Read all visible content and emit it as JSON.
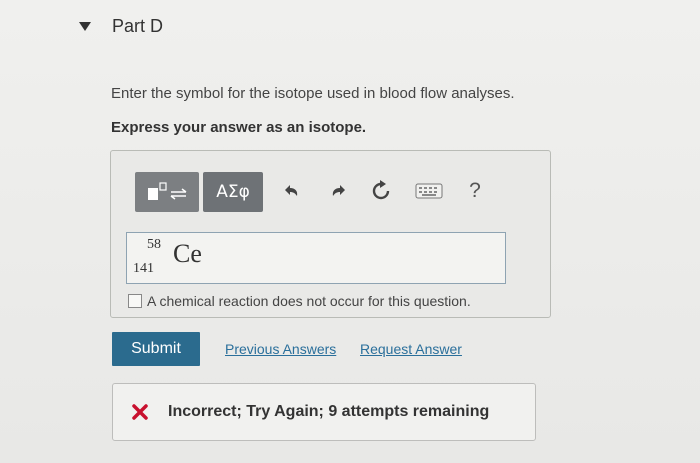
{
  "part": {
    "title": "Part D"
  },
  "question": {
    "prompt": "Enter the symbol for the isotope used in blood flow analyses.",
    "instruction": "Express your answer as an isotope."
  },
  "toolbar": {
    "symbols_label": "ΑΣφ",
    "help_label": "?",
    "icons": [
      "templates-icon",
      "undo-icon",
      "redo-icon",
      "reset-icon",
      "keyboard-icon",
      "help-icon"
    ]
  },
  "answer": {
    "mass_number": "58",
    "atomic_number": "141",
    "symbol": "Ce"
  },
  "no_reaction_label": "A chemical reaction does not occur for this question.",
  "actions": {
    "submit_label": "Submit",
    "previous_answers_label": "Previous Answers",
    "request_answer_label": "Request Answer"
  },
  "feedback": {
    "text": "Incorrect; Try Again; 9 attempts remaining",
    "status_color": "#c8102e"
  },
  "colors": {
    "submit_bg": "#2b6b8e",
    "link": "#2a6f9b"
  }
}
